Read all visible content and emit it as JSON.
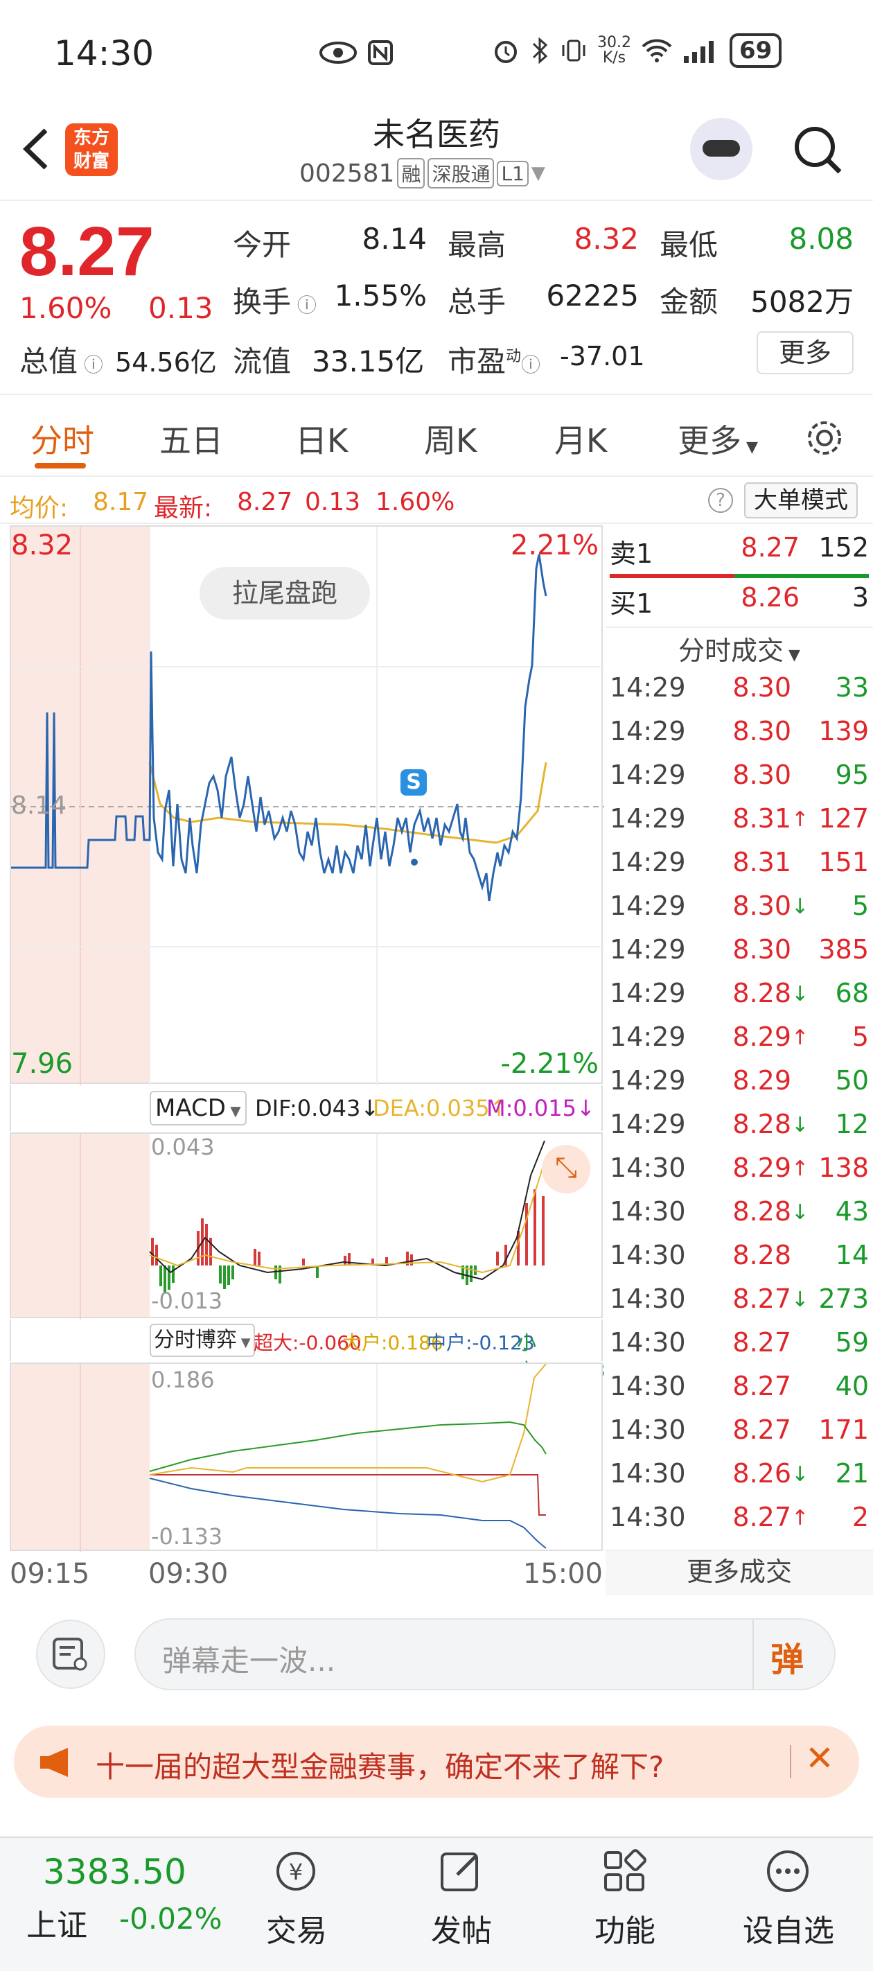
{
  "status": {
    "time": "14:30",
    "net_speed": "30.2\nK/s",
    "battery": "69"
  },
  "header": {
    "name": "未名医药",
    "code": "002581",
    "tags": [
      "融",
      "深股通",
      "L1"
    ],
    "logo": "东方\n财富"
  },
  "quote": {
    "price": "8.27",
    "pct": "1.60%",
    "change": "0.13",
    "open_label": "今开",
    "open": "8.14",
    "high_label": "最高",
    "high": "8.32",
    "low_label": "最低",
    "low": "8.08",
    "turnover_label": "换手",
    "turnover": "1.55%",
    "volume_label": "总手",
    "volume": "62225",
    "amount_label": "金额",
    "amount": "5082万",
    "mktcap_label": "总值",
    "mktcap": "54.56亿",
    "float_label": "流值",
    "float": "33.15亿",
    "pe_label": "市盈",
    "pe_sup": "动",
    "pe": "-37.01",
    "more": "更多"
  },
  "tabs": [
    "分时",
    "五日",
    "日K",
    "周K",
    "月K",
    "更多"
  ],
  "avgbar": {
    "avg_label": "均价:",
    "avg": "8.17",
    "latest_label": "最新:",
    "latest": "8.27",
    "chg": "0.13",
    "pct": "1.60%",
    "mode_btn": "大单模式"
  },
  "chart": {
    "high_price": "8.32",
    "low_price": "7.96",
    "base_price": "8.14",
    "high_pct": "2.21%",
    "low_pct": "-2.21%",
    "pill": "拉尾盘跑",
    "times": [
      "09:15",
      "09:30",
      "15:00"
    ]
  },
  "macd": {
    "label": "MACD",
    "dif": "DIF:0.043",
    "dea": "DEA:0.035",
    "m": "M:0.015",
    "max": "0.043",
    "min": "-0.013"
  },
  "flow": {
    "label": "分时博弈",
    "super": "超大:-0.060",
    "big": "大户:0.186",
    "mid": "中户:-0.123",
    "small": "小户:-0.003",
    "max": "0.186",
    "min": "-0.133"
  },
  "orderbook": {
    "sell1_label": "卖1",
    "sell1_price": "8.27",
    "sell1_vol": "152",
    "buy1_label": "买1",
    "buy1_price": "8.26",
    "buy1_vol": "3",
    "trades_header": "分时成交",
    "trades": [
      {
        "t": "14:29",
        "p": "8.30",
        "a": "",
        "v": "33"
      },
      {
        "t": "14:29",
        "p": "8.30",
        "a": "",
        "v": "139"
      },
      {
        "t": "14:29",
        "p": "8.30",
        "a": "",
        "v": "95"
      },
      {
        "t": "14:29",
        "p": "8.31",
        "a": "↑",
        "v": "127"
      },
      {
        "t": "14:29",
        "p": "8.31",
        "a": "",
        "v": "151"
      },
      {
        "t": "14:29",
        "p": "8.30",
        "a": "↓",
        "v": "5"
      },
      {
        "t": "14:29",
        "p": "8.30",
        "a": "",
        "v": "385"
      },
      {
        "t": "14:29",
        "p": "8.28",
        "a": "↓",
        "v": "68"
      },
      {
        "t": "14:29",
        "p": "8.29",
        "a": "↑",
        "v": "5"
      },
      {
        "t": "14:29",
        "p": "8.29",
        "a": "",
        "v": "50"
      },
      {
        "t": "14:29",
        "p": "8.28",
        "a": "↓",
        "v": "12"
      },
      {
        "t": "14:30",
        "p": "8.29",
        "a": "↑",
        "v": "138"
      },
      {
        "t": "14:30",
        "p": "8.28",
        "a": "↓",
        "v": "43"
      },
      {
        "t": "14:30",
        "p": "8.28",
        "a": "",
        "v": "14"
      },
      {
        "t": "14:30",
        "p": "8.27",
        "a": "↓",
        "v": "273"
      },
      {
        "t": "14:30",
        "p": "8.27",
        "a": "",
        "v": "59"
      },
      {
        "t": "14:30",
        "p": "8.27",
        "a": "",
        "v": "40"
      },
      {
        "t": "14:30",
        "p": "8.27",
        "a": "",
        "v": "171"
      },
      {
        "t": "14:30",
        "p": "8.26",
        "a": "↓",
        "v": "21"
      },
      {
        "t": "14:30",
        "p": "8.27",
        "a": "↑",
        "v": "2"
      }
    ],
    "more_trades": "更多成交"
  },
  "danmu": {
    "placeholder": "弹幕走一波...",
    "send": "弹"
  },
  "banner": {
    "text": "十一届的超大型金融赛事，确定不来了解下?"
  },
  "nav": {
    "index_value": "3383.50",
    "index_name": "上证",
    "index_pct": "-0.02%",
    "items": [
      "交易",
      "发帖",
      "功能",
      "设自选"
    ]
  },
  "colors": {
    "up": "#e0262b",
    "down": "#1a9a2a",
    "accent": "#e06010",
    "price_line": "#2a65b0",
    "avg_line": "#e8b430"
  }
}
